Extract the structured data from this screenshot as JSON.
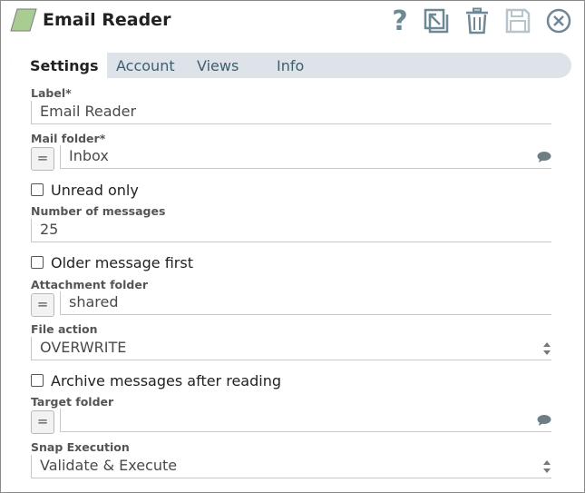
{
  "header": {
    "title": "Email Reader",
    "help_glyph": "?"
  },
  "tabs": [
    {
      "label": "Settings",
      "active": true
    },
    {
      "label": "Account",
      "active": false
    },
    {
      "label": "Views",
      "active": false
    },
    {
      "label": "Info",
      "active": false
    }
  ],
  "form": {
    "label_field": {
      "label": "Label*",
      "value": "Email Reader"
    },
    "mail_folder": {
      "label": "Mail folder*",
      "value": "Inbox",
      "expr_glyph": "="
    },
    "unread_only": {
      "label": "Unread only",
      "checked": false
    },
    "number_of_messages": {
      "label": "Number of messages",
      "value": "25"
    },
    "older_message_first": {
      "label": "Older message first",
      "checked": false
    },
    "attachment_folder": {
      "label": "Attachment folder",
      "value": "shared",
      "expr_glyph": "="
    },
    "file_action": {
      "label": "File action",
      "value": "OVERWRITE"
    },
    "archive_messages": {
      "label": "Archive messages after reading",
      "checked": false
    },
    "target_folder": {
      "label": "Target folder",
      "value": "",
      "expr_glyph": "="
    },
    "snap_execution": {
      "label": "Snap Execution",
      "value": "Validate & Execute"
    }
  },
  "colors": {
    "icon": "#6f8896",
    "tab_bar": "#dde3e8",
    "tab_text": "#3d5f70",
    "snap_icon_fill": "#a9cc92"
  },
  "icons": [
    "snap-type-icon",
    "help-icon",
    "export-icon",
    "delete-icon",
    "save-icon",
    "close-icon",
    "comment-icon"
  ]
}
